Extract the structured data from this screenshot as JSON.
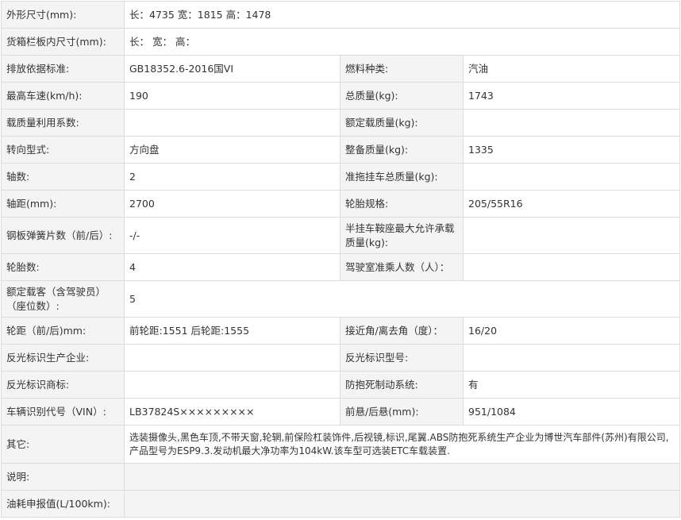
{
  "rows": [
    {
      "l1": "外形尺寸(mm):",
      "v1": "长：4735 宽：1815 高：1478"
    },
    {
      "l1": "货箱栏板内尺寸(mm):",
      "v1": "长： 宽： 高："
    },
    {
      "l1": "排放依据标准:",
      "v1": "GB18352.6-2016国VI",
      "l2": "燃料种类:",
      "v2": "汽油"
    },
    {
      "l1": "最高车速(km/h):",
      "v1": "190",
      "l2": "总质量(kg):",
      "v2": "1743"
    },
    {
      "l1": "载质量利用系数:",
      "v1": "",
      "l2": "额定载质量(kg):",
      "v2": ""
    },
    {
      "l1": "转向型式:",
      "v1": "方向盘",
      "l2": "整备质量(kg):",
      "v2": "1335"
    },
    {
      "l1": "轴数:",
      "v1": "2",
      "l2": "准拖挂车总质量(kg):",
      "v2": ""
    },
    {
      "l1": "轴距(mm):",
      "v1": "2700",
      "l2": "轮胎规格:",
      "v2": "205/55R16"
    },
    {
      "l1": "钢板弹簧片数（前/后）:",
      "v1": "-/-",
      "l2": "半挂车鞍座最大允许承载质量(kg):",
      "v2": ""
    },
    {
      "l1": "轮胎数:",
      "v1": "4",
      "l2": "驾驶室准乘人数（人）：",
      "v2": ""
    },
    {
      "l1": "额定载客（含驾驶员）（座位数）:",
      "v1": "5"
    },
    {
      "l1": "轮距（前/后)mm:",
      "v1": "前轮距:1551 后轮距:1555",
      "l2": "接近角/离去角（度）：",
      "v2": "16/20"
    },
    {
      "l1": "反光标识生产企业:",
      "v1": "",
      "l2": "反光标识型号:",
      "v2": ""
    },
    {
      "l1": "反光标识商标:",
      "v1": "",
      "l2": "防抱死制动系统:",
      "v2": "有"
    },
    {
      "l1": "车辆识别代号（VIN）:",
      "v1": "LB37824S×××××××××",
      "l2": "前悬/后悬(mm):",
      "v2": "951/1084"
    },
    {
      "l1": "其它:",
      "v1": "选装摄像头,黑色车顶,不带天窗,轮辋,前保险杠装饰件,后视镜,标识,尾翼.ABS防抱死系统生产企业为博世汽车部件(苏州)有限公司,产品型号为ESP9.3.发动机最大净功率为104kW.该车型可选装ETC车载装置."
    },
    {
      "l1": "说明:",
      "v1": ""
    },
    {
      "l1": "油耗申报值(L/100km):",
      "v1": ""
    }
  ]
}
